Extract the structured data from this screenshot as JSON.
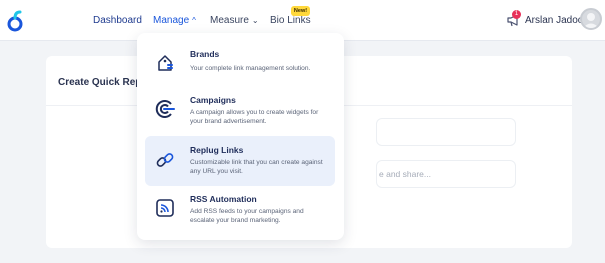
{
  "nav": {
    "dashboard": "Dashboard",
    "manage": "Manage",
    "measure": "Measure",
    "bio_links": "Bio Links",
    "new_badge": "New!"
  },
  "user": {
    "name": "Arslan Jadoon",
    "notification_count": "1"
  },
  "card": {
    "title": "Create Quick Repl",
    "input_placeholder": "e and share..."
  },
  "dropdown": {
    "items": [
      {
        "title": "Brands",
        "desc": "Your complete link management solution.",
        "icon": "brand-tag-icon"
      },
      {
        "title": "Campaigns",
        "desc": "A campaign allows you to create widgets for your brand advertisement.",
        "icon": "campaign-icon"
      },
      {
        "title": "Replug Links",
        "desc": "Customizable link that you can create against any URL you visit.",
        "icon": "link-icon"
      },
      {
        "title": "RSS Automation",
        "desc": "Add RSS feeds to your campaigns and escalate your brand marketing.",
        "icon": "rss-icon"
      }
    ]
  },
  "colors": {
    "accent": "#1a56db",
    "badge": "#ffd83b",
    "notification": "#e8315a",
    "highlight": "#eaf0fb"
  }
}
